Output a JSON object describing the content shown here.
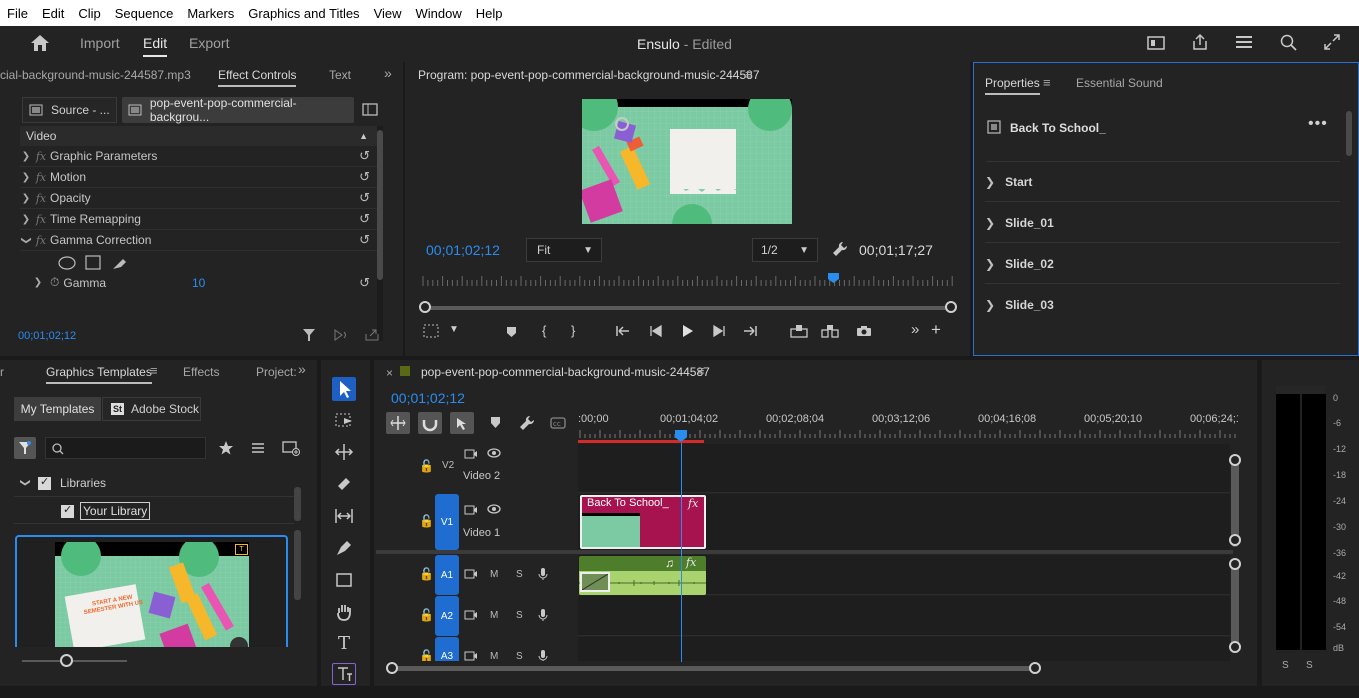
{
  "menu": [
    "File",
    "Edit",
    "Clip",
    "Sequence",
    "Markers",
    "Graphics and Titles",
    "View",
    "Window",
    "Help"
  ],
  "header": {
    "tabs": {
      "import": "Import",
      "edit": "Edit",
      "export": "Export"
    },
    "project_name": "Ensulo",
    "status": "- Edited"
  },
  "effect_controls": {
    "file_tab": "cial-background-music-244587.mp3",
    "tab_effect_controls": "Effect Controls",
    "tab_text": "Text",
    "source_label": "Source - ...",
    "clip_label": "pop-event-pop-commercial-backgrou...",
    "section": "Video",
    "rows": [
      "Graphic Parameters",
      "Motion",
      "Opacity",
      "Time Remapping",
      "Gamma Correction"
    ],
    "gamma_label": "Gamma",
    "gamma_value": "10",
    "timecode": "00;01;02;12"
  },
  "program": {
    "title": "Program: pop-event-pop-commercial-background-music-244587",
    "timecode_current": "00;01;02;12",
    "timecode_duration": "00;01;17;27",
    "fit": "Fit",
    "resolution": "1/2",
    "playhead_fraction": 0.775,
    "poster": {
      "line1": "START A NEW",
      "line2": "SEMESTER WITH US"
    }
  },
  "properties": {
    "tab_properties": "Properties",
    "tab_essential_sound": "Essential Sound",
    "clip_name": "Back To School_",
    "sections": [
      "Start",
      "Slide_01",
      "Slide_02",
      "Slide_03"
    ]
  },
  "graphics_templates": {
    "tab_partial": "r",
    "tab_graphics_templates": "Graphics Templates",
    "tab_effects": "Effects",
    "tab_project": "Project:",
    "my_templates": "My Templates",
    "adobe_stock": "Adobe Stock",
    "libraries": "Libraries",
    "your_library": "Your Library"
  },
  "timeline": {
    "sequence_name": "pop-event-pop-commercial-background-music-244587",
    "timecode": "00;01;02;12",
    "ruler": [
      ":00;00",
      "00;01;04;02",
      "00;02;08;04",
      "00;03;12;06",
      "00;04;16;08",
      "00;05;20;10",
      "00;06;24;1"
    ],
    "tracks_video": [
      {
        "id": "V2",
        "name": "Video 2"
      },
      {
        "id": "V1",
        "name": "Video 1"
      }
    ],
    "tracks_audio": [
      {
        "id": "A1"
      },
      {
        "id": "A2"
      },
      {
        "id": "A3"
      }
    ],
    "video_clip": "Back To School_",
    "fx": "fx",
    "mute": "M",
    "solo": "S"
  },
  "audio_meter": {
    "scale": [
      "0",
      "-6",
      "-12",
      "-18",
      "-24",
      "-30",
      "-36",
      "-42",
      "-48",
      "-54"
    ],
    "db": "dB",
    "solo_left": "S",
    "solo_right": "S"
  },
  "colors": {
    "accent": "#2b8cf0",
    "track_target": "#1f6dd1",
    "video_clip": "#a6134f",
    "audio_clip": "#4e7d2b",
    "poster_bg": "#7ccaa3"
  }
}
